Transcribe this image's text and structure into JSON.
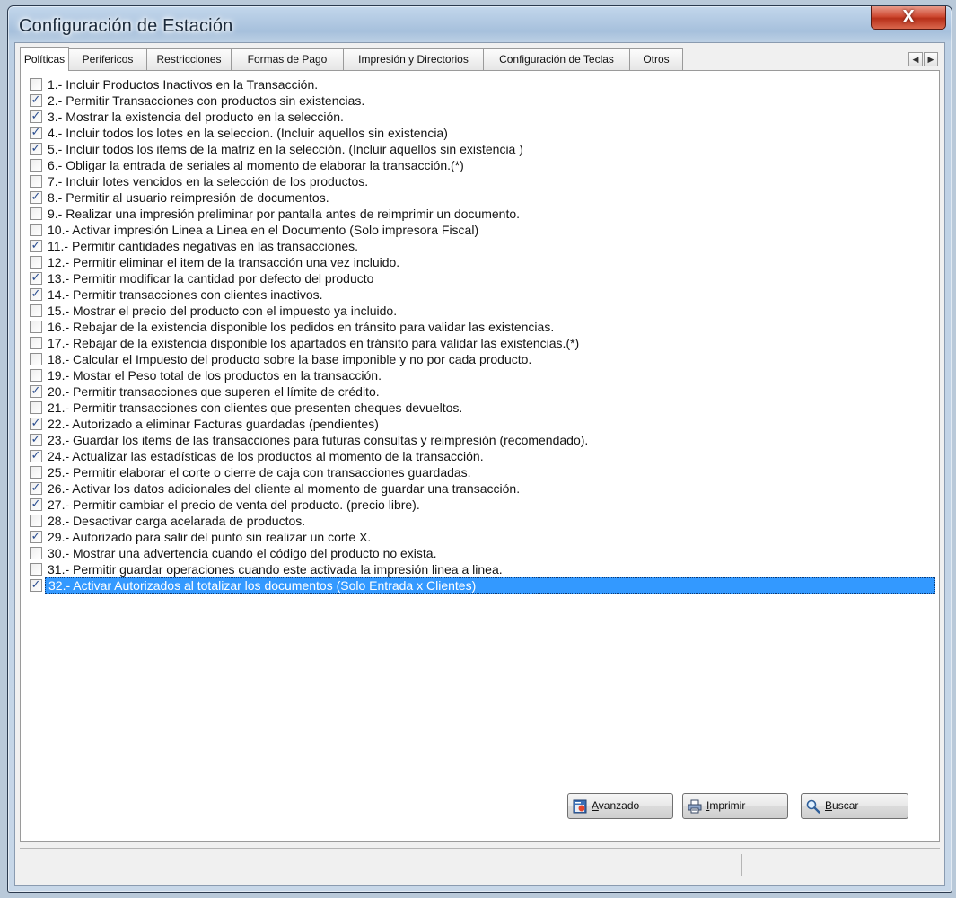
{
  "window": {
    "title": "Configuración de Estación",
    "close_label": "X"
  },
  "tabs": [
    {
      "label": "Políticas",
      "active": true
    },
    {
      "label": "Perifericos"
    },
    {
      "label": "Restricciones"
    },
    {
      "label": "Formas de Pago"
    },
    {
      "label": "Impresión y Directorios"
    },
    {
      "label": "Configuración de Teclas"
    },
    {
      "label": "Otros"
    }
  ],
  "tab_scroll": {
    "left": "◀",
    "right": "▶"
  },
  "policies": [
    {
      "label": "1.- Incluir Productos Inactivos en la Transacción.",
      "checked": false
    },
    {
      "label": "2.- Permitir Transacciones con productos sin existencias.",
      "checked": true
    },
    {
      "label": "3.- Mostrar  la existencia del producto en la selección.",
      "checked": true
    },
    {
      "label": "4.- Incluir todos los lotes en la seleccion. (Incluir aquellos sin existencia)",
      "checked": true
    },
    {
      "label": "5.- Incluir todos los items de la matriz en la selección. (Incluir aquellos sin existencia )",
      "checked": true
    },
    {
      "label": "6.- Obligar la entrada de seriales al momento de elaborar la transacción.(*)",
      "checked": false
    },
    {
      "label": "7.- Incluir lotes vencidos en la selección de los productos.",
      "checked": false
    },
    {
      "label": "8.- Permitir al usuario reimpresión de documentos.",
      "checked": true
    },
    {
      "label": "9.- Realizar una impresión preliminar por pantalla antes de reimprimir un documento.",
      "checked": false
    },
    {
      "label": "10.- Activar impresión Linea a Linea en el Documento (Solo impresora Fiscal)",
      "checked": false
    },
    {
      "label": "11.- Permitir cantidades negativas en las transacciones.",
      "checked": true
    },
    {
      "label": "12.- Permitir eliminar el item de la transacción una vez incluido.",
      "checked": false
    },
    {
      "label": "13.- Permitir modificar la cantidad por defecto del producto",
      "checked": true
    },
    {
      "label": "14.- Permitir transacciones con clientes inactivos.",
      "checked": true
    },
    {
      "label": "15.- Mostrar el precio del producto con el impuesto ya incluido.",
      "checked": false
    },
    {
      "label": "16.- Rebajar de la existencia disponible los pedidos en tránsito para validar las existencias.",
      "checked": false
    },
    {
      "label": "17.- Rebajar de la existencia disponible los apartados en tránsito para validar las existencias.(*)",
      "checked": false
    },
    {
      "label": "18.- Calcular el Impuesto del producto sobre la base imponible y no por cada producto.",
      "checked": false
    },
    {
      "label": "19.- Mostar el Peso total de los productos en la transacción.",
      "checked": false
    },
    {
      "label": "20.- Permitir transacciones que superen el límite de crédito.",
      "checked": true
    },
    {
      "label": "21.- Permitir transacciones con clientes que presenten cheques devueltos.",
      "checked": false
    },
    {
      "label": "22.- Autorizado a eliminar Facturas guardadas (pendientes)",
      "checked": true
    },
    {
      "label": "23.- Guardar los items de las transacciones para futuras consultas y reimpresión (recomendado).",
      "checked": true
    },
    {
      "label": "24.- Actualizar las estadísticas de los productos al momento de la transacción.",
      "checked": true
    },
    {
      "label": "25.- Permitir elaborar el corte o cierre de caja con transacciones guardadas.",
      "checked": false
    },
    {
      "label": "26.- Activar los datos adicionales del cliente al momento de guardar una transacción.",
      "checked": true
    },
    {
      "label": "27.- Permitir cambiar el precio de venta del producto. (precio libre).",
      "checked": true
    },
    {
      "label": "28.- Desactivar carga acelarada de productos.",
      "checked": false
    },
    {
      "label": "29.- Autorizado para salir del punto sin realizar un corte X.",
      "checked": true
    },
    {
      "label": "30.- Mostrar una advertencia cuando el código del producto no exista.",
      "checked": false
    },
    {
      "label": "31.- Permitir guardar operaciones cuando este activada la impresión linea a linea.",
      "checked": false
    },
    {
      "label": "32.- Activar Autorizados al totalizar los documentos (Solo Entrada x Clientes)",
      "checked": true,
      "selected": true
    }
  ],
  "buttons": {
    "avanzado": {
      "mnemonic": "A",
      "rest": "vanzado"
    },
    "imprimir": {
      "mnemonic": "I",
      "rest": "mprimir"
    },
    "buscar": {
      "mnemonic": "B",
      "rest": "uscar"
    }
  },
  "colors": {
    "selection": "#3399ff",
    "check": "#2a4d8f",
    "close_button": "#c8432d"
  }
}
